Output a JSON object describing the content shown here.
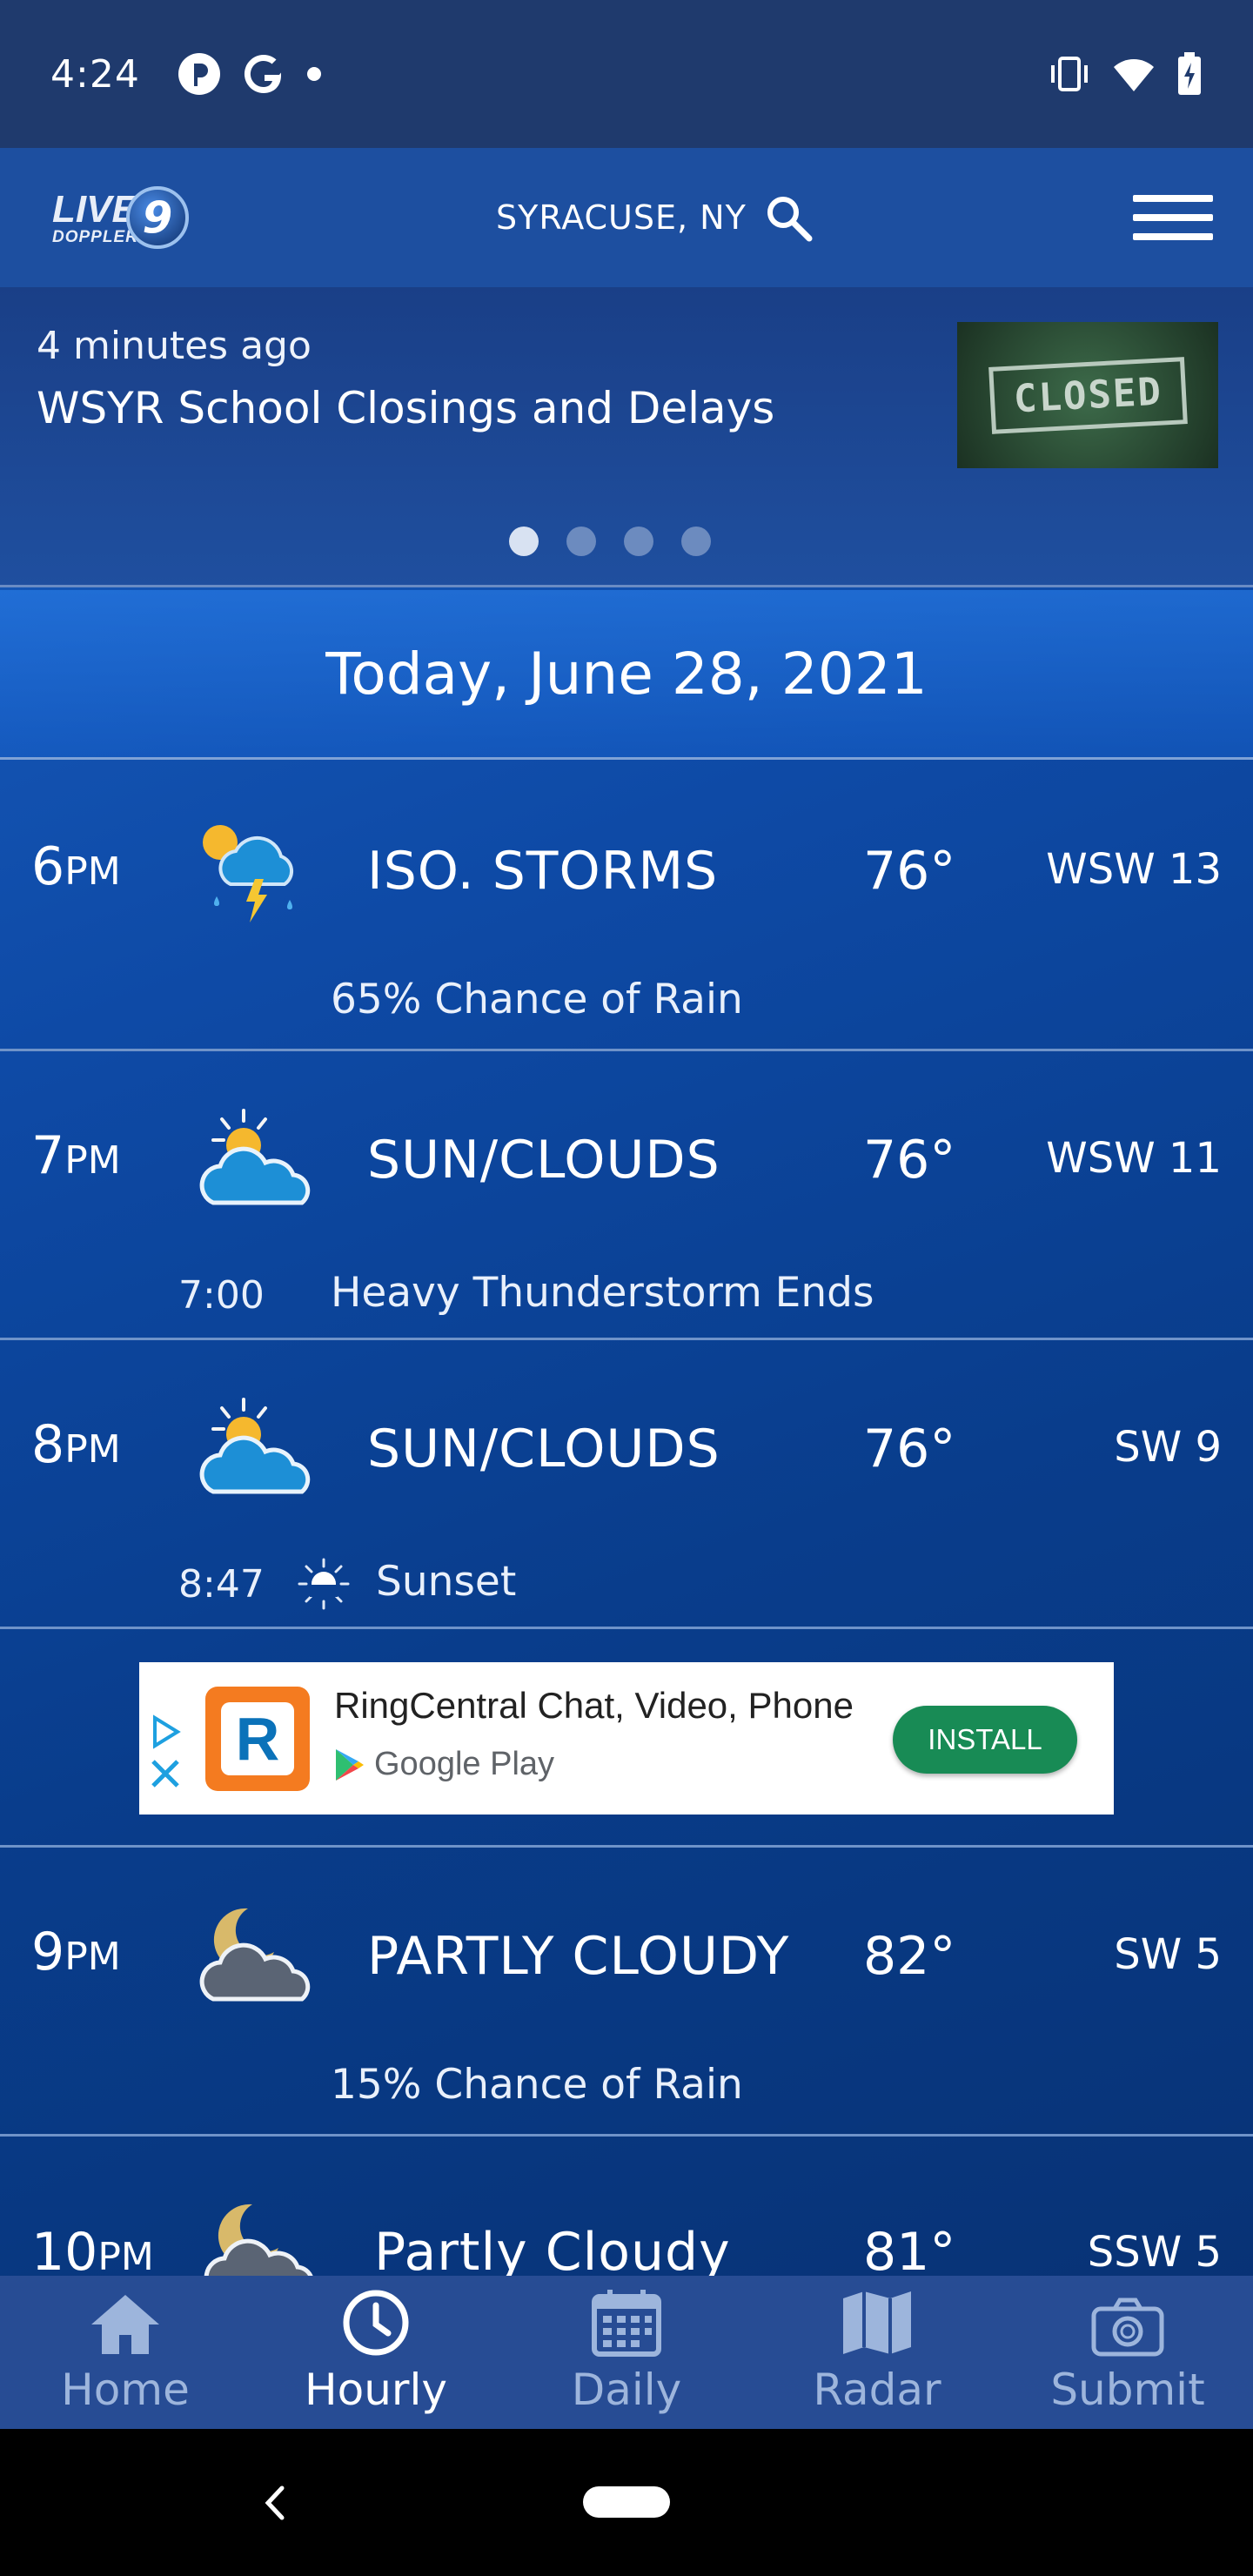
{
  "status_bar": {
    "time": "4:24",
    "left_icons": [
      "location-pin-icon",
      "google-icon",
      "notification-dot-icon"
    ],
    "right_icons": [
      "vibrate-icon",
      "wifi-icon",
      "battery-charging-icon"
    ]
  },
  "header": {
    "logo_line1": "LIVE",
    "logo_line2": "DOPPLER",
    "logo_number": "9",
    "location": "SYRACUSE, NY"
  },
  "news": {
    "time_ago": "4 minutes ago",
    "headline": "WSYR School Closings and Delays",
    "thumb_text": "CLOSED",
    "pages": 4,
    "active_page": 1
  },
  "date": "Today, June 28, 2021",
  "hours": [
    {
      "hour": "6",
      "ampm": "PM",
      "icon": "sun-storm-cloud-icon",
      "condition": "ISO. STORMS",
      "temp": "76°",
      "wind": "WSW 13",
      "sub": "65% Chance of Rain"
    },
    {
      "hour": "7",
      "ampm": "PM",
      "icon": "sun-cloud-icon",
      "condition": "SUN/CLOUDS",
      "temp": "76°",
      "wind": "WSW 11",
      "sub_time": "7:00",
      "sub_text": "Heavy Thunderstorm Ends"
    },
    {
      "hour": "8",
      "ampm": "PM",
      "icon": "sun-cloud-icon",
      "condition": "SUN/CLOUDS",
      "temp": "76°",
      "wind": "SW 9",
      "sub_time": "8:47",
      "sub_text": "Sunset"
    },
    {
      "hour": "9",
      "ampm": "PM",
      "icon": "moon-cloud-icon",
      "condition": "PARTLY CLOUDY",
      "temp": "82°",
      "wind": "SW 5",
      "sub": "15% Chance of Rain"
    },
    {
      "hour": "10",
      "ampm": "PM",
      "icon": "moon-cloud-icon",
      "condition": "Partly Cloudy",
      "temp": "81°",
      "wind": "SSW 5"
    }
  ],
  "ad": {
    "app_name": "RingCentral Chat, Video, Phone",
    "store": "Google Play",
    "install_label": "INSTALL"
  },
  "bottom_nav": [
    {
      "label": "Home",
      "icon": "home-icon",
      "active": false
    },
    {
      "label": "Hourly",
      "icon": "clock-icon",
      "active": true
    },
    {
      "label": "Daily",
      "icon": "calendar-icon",
      "active": false
    },
    {
      "label": "Radar",
      "icon": "map-icon",
      "active": false
    },
    {
      "label": "Submit",
      "icon": "camera-icon",
      "active": false
    }
  ],
  "colors": {
    "status_bar": "#1f3a6d",
    "header": "#1d4fa0",
    "nav_bar": "#274c94",
    "install_button": "#188b55"
  }
}
